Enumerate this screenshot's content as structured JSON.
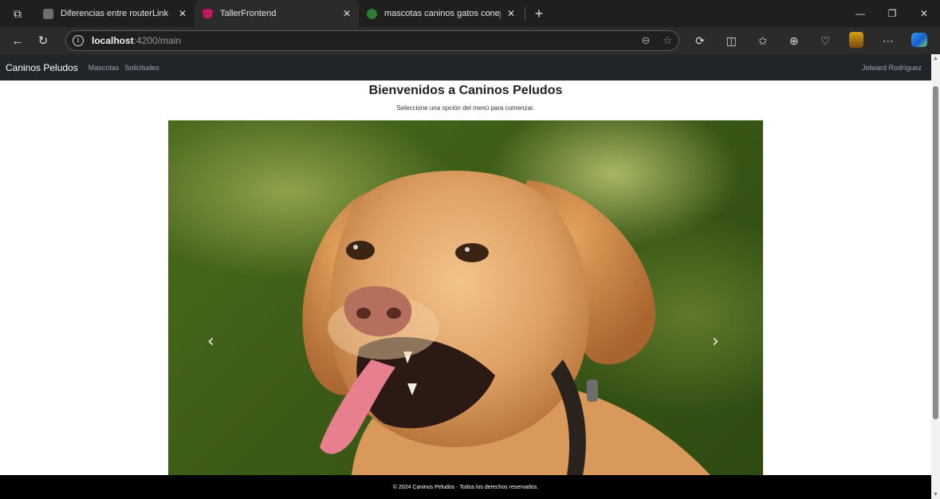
{
  "browser": {
    "tabs": [
      {
        "title": "Diferencias entre routerLink",
        "favicon_color": "#6e6e6e",
        "active": false
      },
      {
        "title": "TallerFrontend",
        "favicon_color": "#c2185b",
        "active": true
      },
      {
        "title": "mascotas caninos gatos conejos -",
        "favicon_color": "#2e7d32",
        "active": false
      }
    ],
    "tab_close_glyph": "✕",
    "new_tab_glyph": "+",
    "url_host": "localhost",
    "url_path": ":4200/main"
  },
  "navbar": {
    "brand": "Caninos Peludos",
    "links": [
      "Mascotas",
      "Solicitudes"
    ],
    "user": "Jidward Rodríguez"
  },
  "main": {
    "title": "Bienvenidos a Caninos Peludos",
    "subtitle": "Seleccione una opción del menú para comenzar.",
    "carousel": {
      "prev_glyph": "‹",
      "next_glyph": "›"
    }
  },
  "footer": {
    "text": "© 2024 Caninos Peludos - Todos los derechos reservados."
  }
}
